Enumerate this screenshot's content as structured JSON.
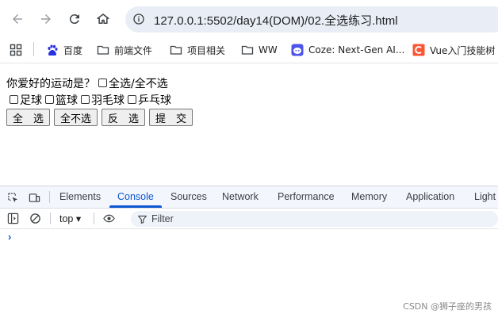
{
  "browser": {
    "url": "127.0.0.1:5502/day14(DOM)/02.全选练习.html",
    "icons": [
      "back-icon",
      "forward-icon",
      "reload-icon",
      "home-icon",
      "site-info-icon"
    ]
  },
  "bookmarks": [
    {
      "label": "百度",
      "icon": "baidu-paw-icon"
    },
    {
      "label": "前端文件",
      "icon": "folder-icon"
    },
    {
      "label": "项目相关",
      "icon": "folder-icon"
    },
    {
      "label": "WW",
      "icon": "folder-icon"
    },
    {
      "label": "Coze: Next-Gen AI...",
      "icon": "coze-icon"
    },
    {
      "label": "Vue入门技能树",
      "icon": "csdn-icon"
    }
  ],
  "page": {
    "question": "你爱好的运动是？",
    "select_all_label": "全选/全不选",
    "sports": [
      "足球",
      "篮球",
      "羽毛球",
      "乒乓球"
    ],
    "buttons": {
      "select_all": "全　选",
      "select_none": "全不选",
      "invert": "反　选",
      "submit": "提　交"
    }
  },
  "devtools": {
    "tabs": [
      "Elements",
      "Console",
      "Sources",
      "Network",
      "Performance",
      "Memory",
      "Application",
      "Light"
    ],
    "active_tab": "Console",
    "context": "top",
    "filter_placeholder": "Filter",
    "prompt": "›"
  },
  "watermark": "CSDN @狮子座的男孩",
  "colors": {
    "accent": "#0b57d0",
    "omnibox": "#e9eef6",
    "devtools_bar": "#f3f6fc"
  }
}
